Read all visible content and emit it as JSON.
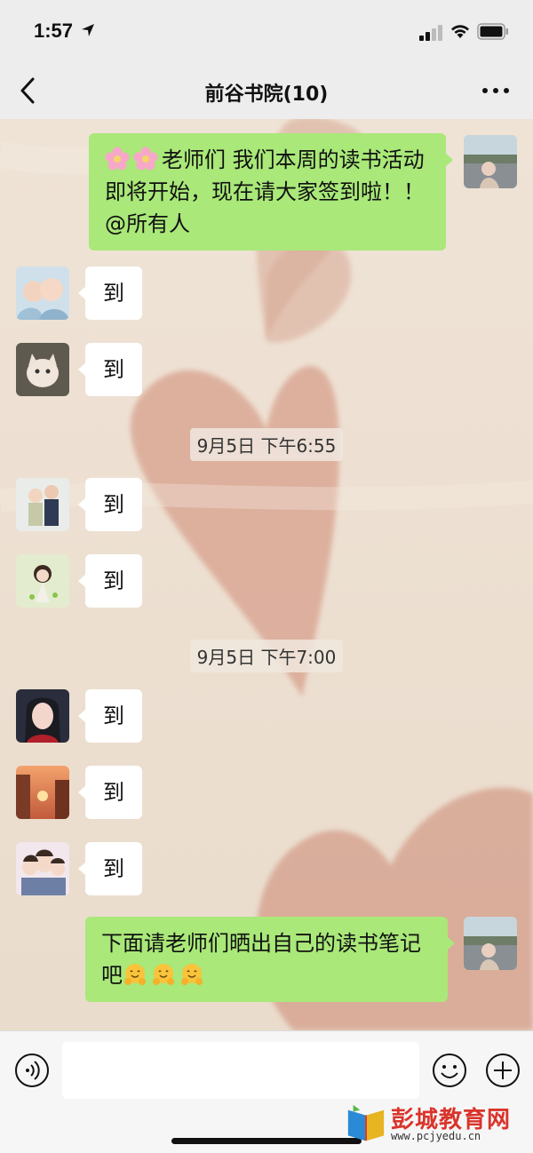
{
  "status_bar": {
    "time": "1:57"
  },
  "nav": {
    "title": "前谷书院(10)"
  },
  "messages": {
    "m1": "老师们 我们本周的读书活动即将开始，现在请大家签到啦！！@所有人",
    "m2": "到",
    "m3": "到",
    "t1": "9月5日 下午6:55",
    "m4": "到",
    "m5": "到",
    "t2": "9月5日 下午7:00",
    "m6": "到",
    "m7": "到",
    "m8": "到",
    "m9": "下面请老师们晒出自己的读书笔记吧"
  },
  "watermark": {
    "name": "彭城教育网",
    "url": "www.pcjyedu.cn"
  },
  "colors": {
    "self_bubble": "#a9e879",
    "other_bubble": "#ffffff",
    "bar_bg": "#ededed"
  }
}
